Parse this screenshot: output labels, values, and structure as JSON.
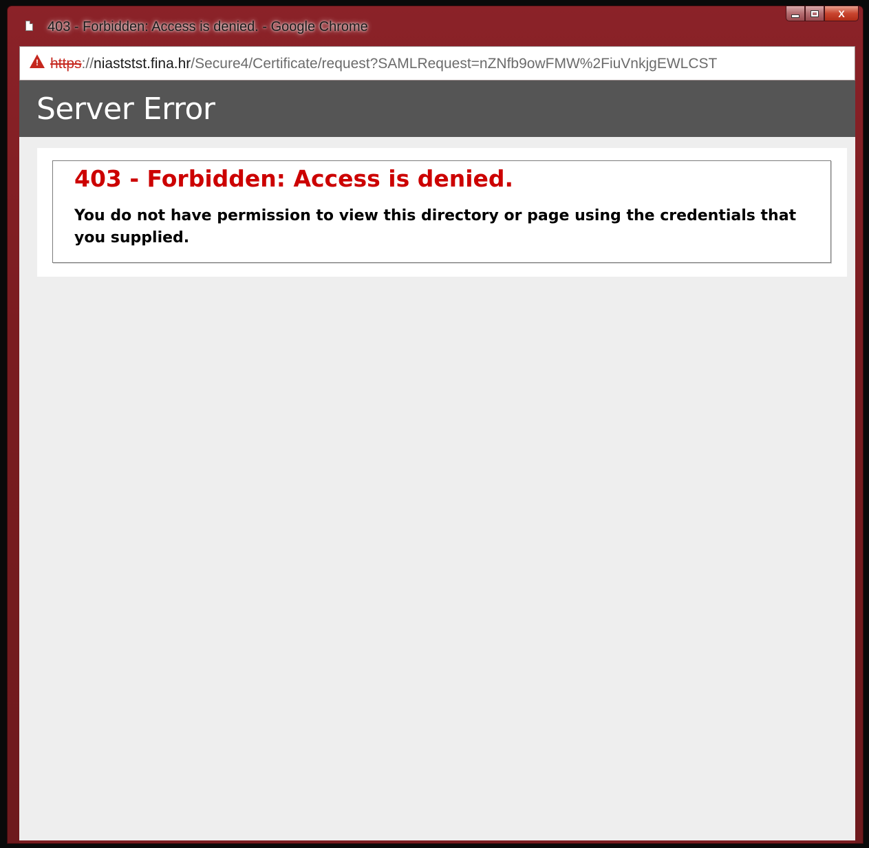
{
  "window": {
    "title": "403 - Forbidden: Access is denied. - Google Chrome",
    "close_label": "X"
  },
  "addressbar": {
    "scheme": "https",
    "host_prefix": "://",
    "host": "niaststst.fina.hr",
    "path": "/Secure4/Certificate/request?SAMLRequest=nZNfb9owFMW%2FiuVnkjgEWLCST"
  },
  "page": {
    "header_title": "Server Error",
    "error_heading": "403 - Forbidden: Access is denied.",
    "error_message": "You do not have permission to view this directory or page using the credentials that you supplied."
  },
  "colors": {
    "titlebar": "#8b2228",
    "header_bg": "#555555",
    "error_red": "#cc0000",
    "page_bg": "#eeeeee"
  }
}
